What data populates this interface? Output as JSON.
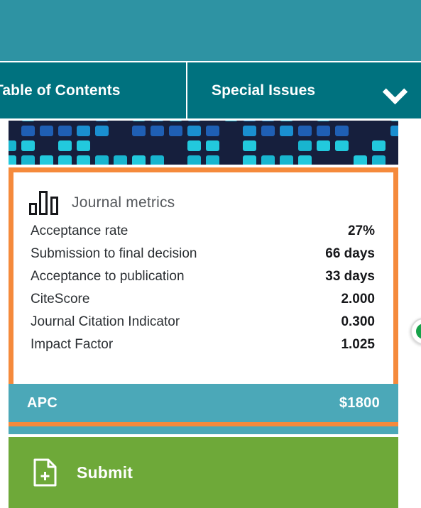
{
  "colors": {
    "hero_teal": "#2E93A3",
    "nav_teal": "#00727F",
    "banner_navy": "#161f3d",
    "orange_border": "#F58A3C",
    "apc_teal": "#4BA8B8",
    "submit_green": "#6EA939",
    "badge_green": "#17A24A",
    "metric_label": "#2b2f33",
    "metric_value": "#16171a",
    "title_gray": "#55585c"
  },
  "nav": {
    "items": [
      {
        "label": "Table of Contents",
        "icon": "",
        "has_chevron": false
      },
      {
        "label": "Special Issues",
        "icon": "chevron-down-icon",
        "has_chevron": true
      }
    ]
  },
  "journal_metrics": {
    "icon": "bar-chart-icon",
    "title": "Journal metrics",
    "rows": [
      {
        "label": "Acceptance rate",
        "value": "27%"
      },
      {
        "label": "Submission to final decision",
        "value": "66 days"
      },
      {
        "label": "Acceptance to publication",
        "value": "33 days"
      },
      {
        "label": "CiteScore",
        "value": "2.000"
      },
      {
        "label": "Journal Citation Indicator",
        "value": "0.300"
      },
      {
        "label": "Impact Factor",
        "value": "1.025"
      }
    ],
    "apc": {
      "label": "APC",
      "value": "$1800"
    }
  },
  "submit": {
    "icon": "document-plus-icon",
    "label": "Submit"
  },
  "edge_badge": {
    "icon": "green-status-dot-icon"
  }
}
